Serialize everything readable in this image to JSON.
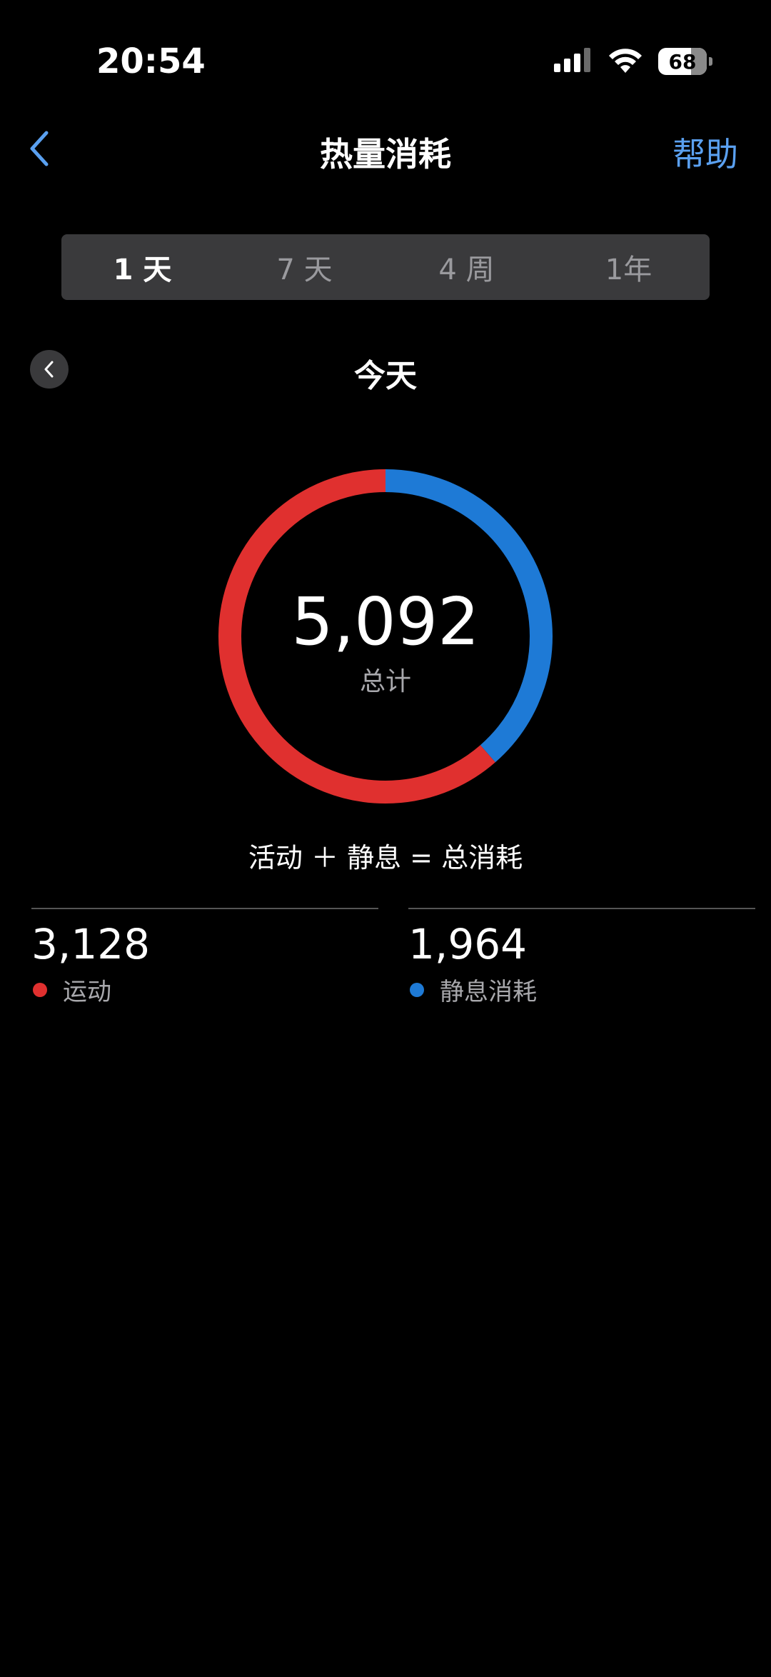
{
  "status_bar": {
    "time": "20:54",
    "battery": "68"
  },
  "nav": {
    "title": "热量消耗",
    "help": "帮助"
  },
  "segments": [
    {
      "label": "1 天",
      "active": true
    },
    {
      "label": "7 天",
      "active": false
    },
    {
      "label": "4 周",
      "active": false
    },
    {
      "label": "1年",
      "active": false
    }
  ],
  "date_title": "今天",
  "ring": {
    "total": "5,092",
    "total_label": "总计"
  },
  "equation": "活动 ＋ 静息 = 总消耗",
  "stats": [
    {
      "value": "3,128",
      "label": "运动",
      "color": "#e0302f"
    },
    {
      "value": "1,964",
      "label": "静息消耗",
      "color": "#1e7ad6"
    }
  ],
  "colors": {
    "active": "#e0302f",
    "resting": "#1e7ad6",
    "link": "#5aa0f0"
  },
  "chart_data": {
    "type": "pie",
    "categories": [
      "运动",
      "静息消耗"
    ],
    "values": [
      3128,
      1964
    ]
  }
}
